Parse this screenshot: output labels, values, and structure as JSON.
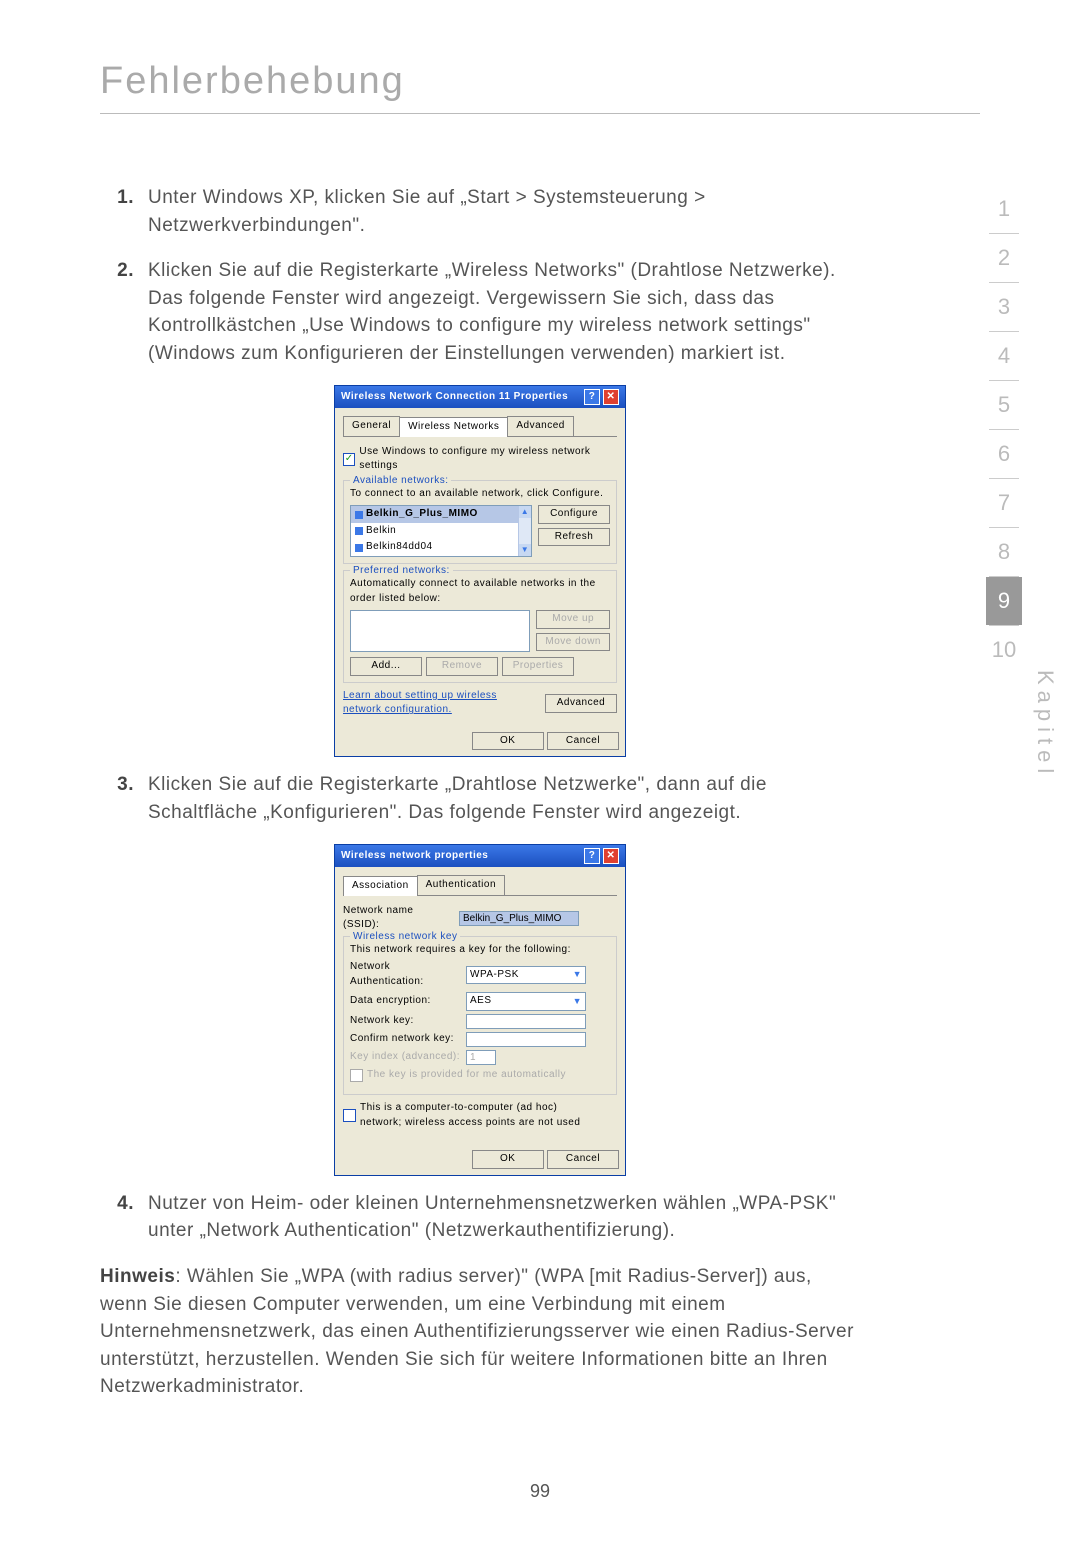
{
  "page": {
    "title": "Fehlerbehebung",
    "number": "99",
    "side_label": "Kapitel",
    "nav": {
      "items": [
        "1",
        "2",
        "3",
        "4",
        "5",
        "6",
        "7",
        "8",
        "9",
        "10"
      ],
      "active": 8
    }
  },
  "steps": {
    "s1": {
      "num": "1.",
      "text": "Unter Windows XP, klicken Sie auf „Start > Systemsteuerung > Netzwerkverbindungen\"."
    },
    "s2": {
      "num": "2.",
      "text": "Klicken Sie auf die Registerkarte „Wireless Networks\" (Drahtlose Netzwerke). Das folgende Fenster wird angezeigt. Vergewissern Sie sich, dass das Kontrollkästchen „Use Windows to configure my wireless network settings\" (Windows zum Konfigurieren der Einstellungen verwenden) markiert ist."
    },
    "s3": {
      "num": "3.",
      "text": "Klicken Sie auf die Registerkarte „Drahtlose Netzwerke\", dann auf die Schaltfläche „Konfigurieren\". Das folgende Fenster wird angezeigt."
    },
    "s4": {
      "num": "4.",
      "text": "Nutzer von Heim- oder kleinen Unternehmensnetzwerken wählen „WPA-PSK\" unter „Network Authentication\" (Netzwerkauthentifizierung)."
    }
  },
  "note": {
    "label": "Hinweis",
    "text": ": Wählen Sie „WPA (with radius server)\" (WPA [mit Radius-Server]) aus, wenn Sie diesen Computer verwenden, um eine Verbindung mit einem Unternehmensnetzwerk, das einen Authentifizierungsserver wie einen Radius-Server unterstützt, herzustellen. Wenden Sie sich für weitere Informationen bitte an Ihren Netzwerkadministrator."
  },
  "dlg1": {
    "title": "Wireless Network Connection 11 Properties",
    "tabs": {
      "general": "General",
      "wireless": "Wireless Networks",
      "advanced": "Advanced"
    },
    "chk_label": "Use Windows to configure my wireless network settings",
    "avail_legend": "Available networks:",
    "avail_text": "To connect to an available network, click Configure.",
    "net1": "Belkin_G_Plus_MIMO",
    "net2": "Belkin",
    "net3": "Belkin84dd04",
    "btn_configure": "Configure",
    "btn_refresh": "Refresh",
    "pref_legend": "Preferred networks:",
    "pref_text": "Automatically connect to available networks in the order listed below:",
    "btn_moveup": "Move up",
    "btn_movedown": "Move down",
    "btn_add": "Add...",
    "btn_remove": "Remove",
    "btn_props": "Properties",
    "learn": "Learn about setting up wireless network configuration.",
    "btn_advanced": "Advanced",
    "btn_ok": "OK",
    "btn_cancel": "Cancel"
  },
  "dlg2": {
    "title": "Wireless network properties",
    "tabs": {
      "assoc": "Association",
      "auth": "Authentication"
    },
    "ssid_label": "Network name (SSID):",
    "ssid_value": "Belkin_G_Plus_MIMO",
    "key_legend": "Wireless network key",
    "key_text": "This network requires a key for the following:",
    "auth_label": "Network Authentication:",
    "auth_value": "WPA-PSK",
    "enc_label": "Data encryption:",
    "enc_value": "AES",
    "netkey_label": "Network key:",
    "confirm_label": "Confirm network key:",
    "keyidx_label": "Key index (advanced):",
    "keyidx_value": "1",
    "chk_auto": "The key is provided for me automatically",
    "chk_adhoc": "This is a computer-to-computer (ad hoc) network; wireless access points are not used",
    "btn_ok": "OK",
    "btn_cancel": "Cancel"
  }
}
